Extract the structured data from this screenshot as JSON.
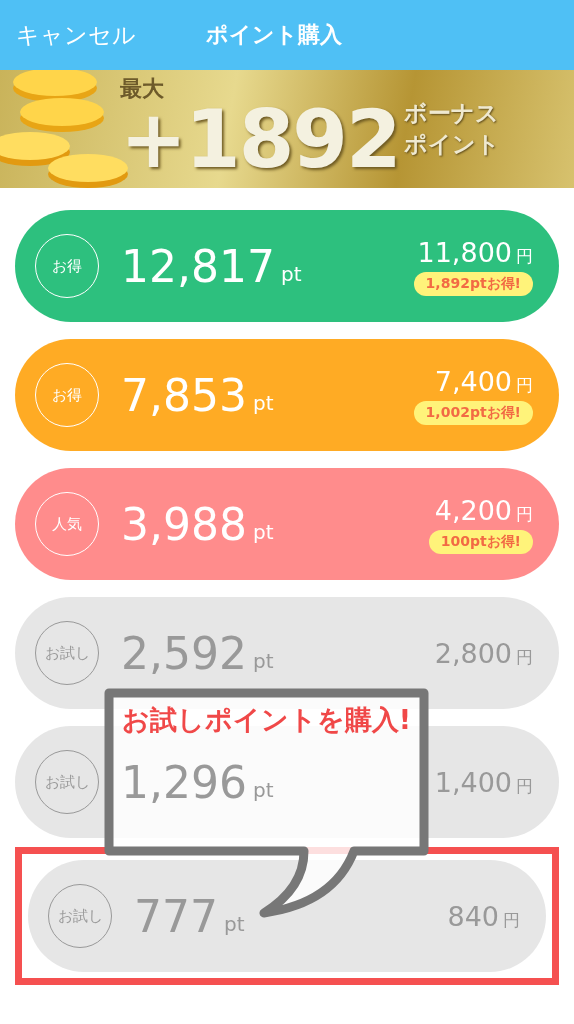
{
  "header": {
    "cancel": "キャンセル",
    "title": "ポイント購入"
  },
  "banner": {
    "prefix": "最大",
    "amount": "+1892",
    "line_1": "ボーナス",
    "line_2": "ポイント"
  },
  "plans": [
    {
      "badge": "お得",
      "points": "12,817",
      "unit": "pt",
      "price": "11,800",
      "currency": "円",
      "bonus": "1,892ptお得!",
      "color": "#2dc07e",
      "kind": "deal",
      "highlighted": false
    },
    {
      "badge": "お得",
      "points": "7,853",
      "unit": "pt",
      "price": "7,400",
      "currency": "円",
      "bonus": "1,002ptお得!",
      "color": "#ffab24",
      "kind": "deal",
      "highlighted": false
    },
    {
      "badge": "人気",
      "points": "3,988",
      "unit": "pt",
      "price": "4,200",
      "currency": "円",
      "bonus": "100ptお得!",
      "color": "#ff8c8c",
      "kind": "deal",
      "highlighted": false
    },
    {
      "badge": "お試し",
      "points": "2,592",
      "unit": "pt",
      "price": "2,800",
      "currency": "円",
      "color": "#e6e6e6",
      "kind": "trial",
      "highlighted": false
    },
    {
      "badge": "お試し",
      "points": "1,296",
      "unit": "pt",
      "price": "1,400",
      "currency": "円",
      "color": "#e6e6e6",
      "kind": "trial",
      "highlighted": false
    },
    {
      "badge": "お試し",
      "points": "777",
      "unit": "pt",
      "price": "840",
      "currency": "円",
      "color": "#e6e6e6",
      "kind": "trial",
      "highlighted": true
    }
  ],
  "callout": {
    "text": "お試しポイントを購入!"
  }
}
